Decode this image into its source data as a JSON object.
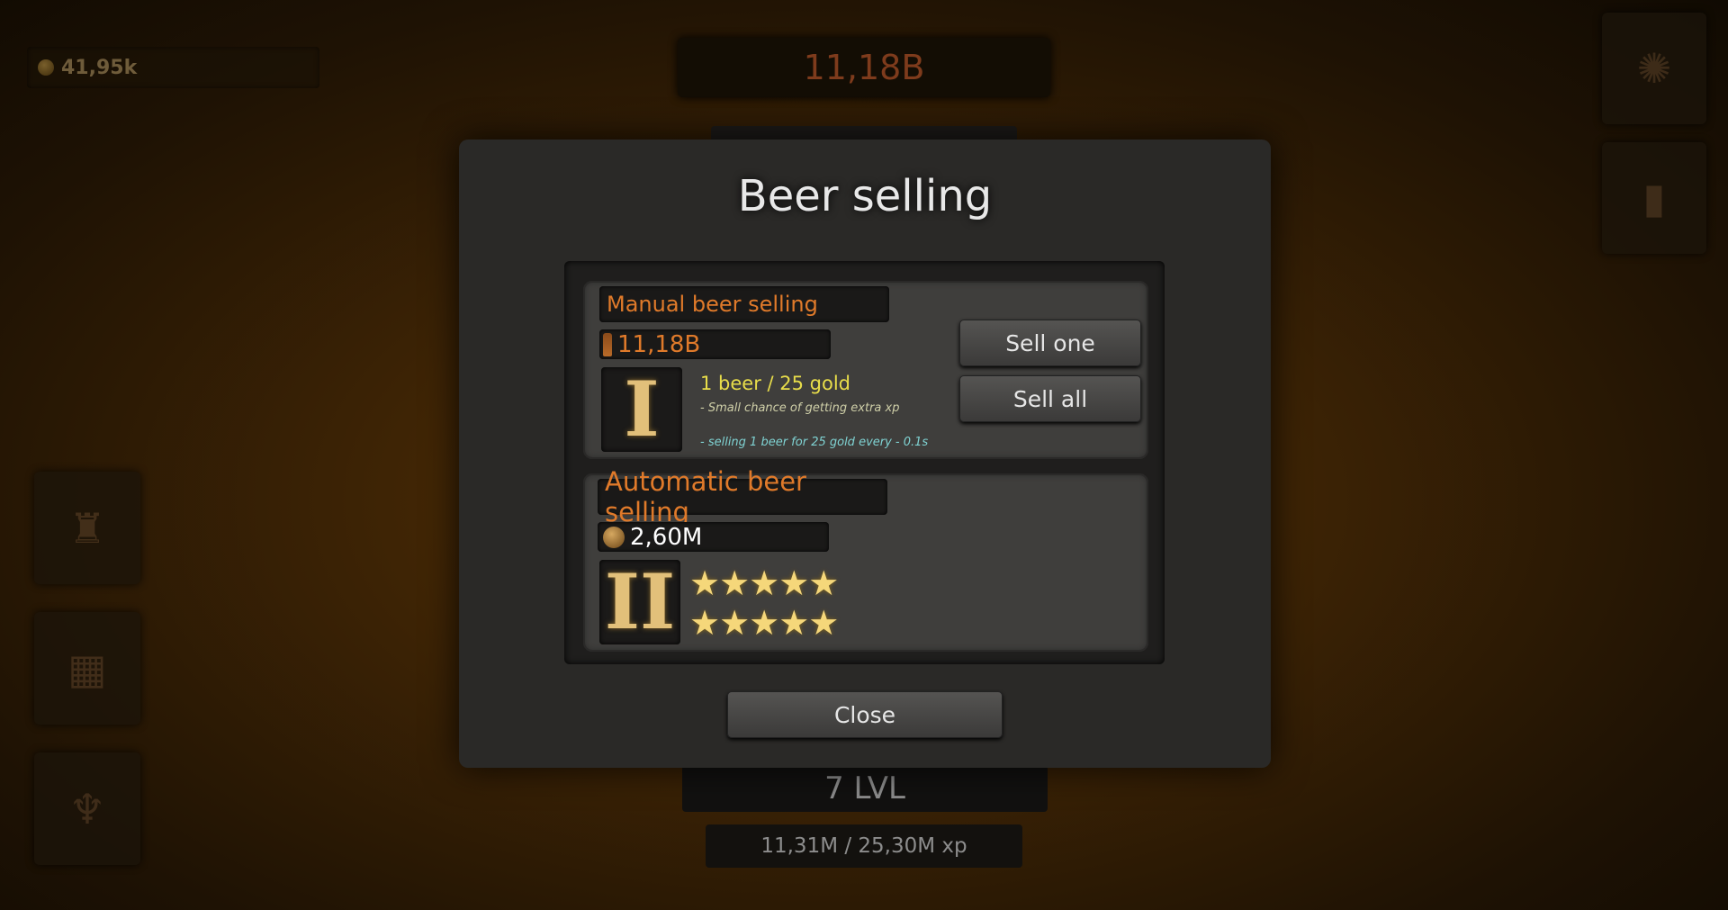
{
  "hud": {
    "gold": "41,95k",
    "beer_count": "11,18B",
    "level": "7 LVL",
    "xp": "11,31M / 25,30M xp"
  },
  "modal": {
    "title": "Beer selling",
    "manual": {
      "heading": "Manual beer selling",
      "stock": "11,18B",
      "tier": "I",
      "rate": "1 beer / 25 gold",
      "note_chance": "- Small chance of getting extra xp",
      "note_selling": "- selling 1 beer for 25 gold every - 0.1s",
      "sell_one_label": "Sell one",
      "sell_all_label": "Sell all"
    },
    "automatic": {
      "heading": "Automatic beer selling",
      "cost": "2,60M",
      "tier": "II",
      "stars_row1": "★★★★★",
      "stars_row2": "★★★★★"
    },
    "close_label": "Close"
  },
  "side_buttons": [
    "lamp-icon",
    "crate-icon",
    "decoration-icon"
  ],
  "top_right_buttons": [
    "settings-icon",
    "stats-icon"
  ],
  "colors": {
    "accent_orange": "#e07a2a",
    "rate_yellow": "#e8dd4a",
    "note_cyan": "#7fd2d2",
    "star_gold": "#f5d77a"
  }
}
